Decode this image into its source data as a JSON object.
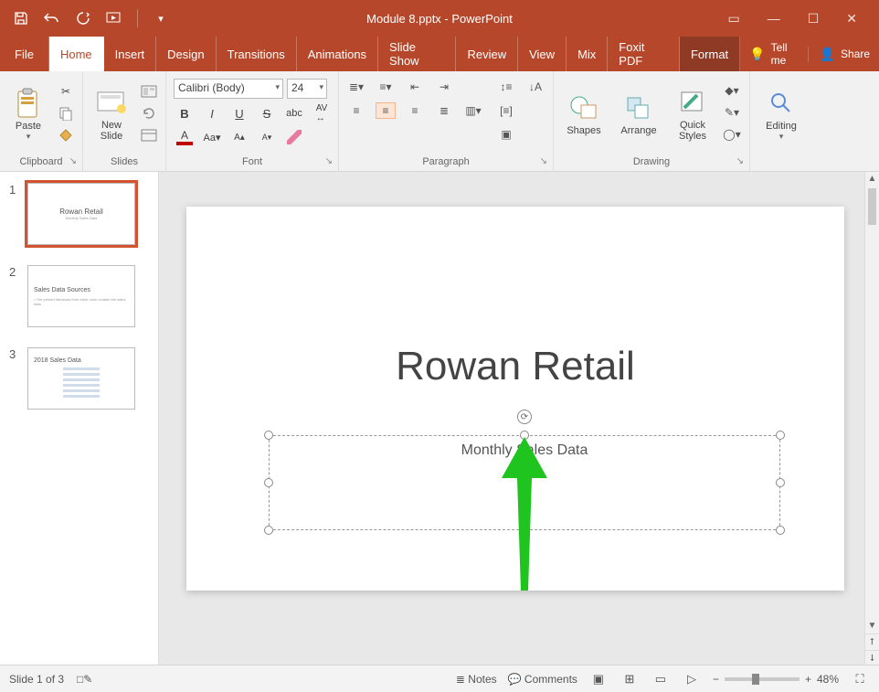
{
  "title": "Module 8.pptx - PowerPoint",
  "menu": {
    "file": "File",
    "home": "Home",
    "insert": "Insert",
    "design": "Design",
    "transitions": "Transitions",
    "animations": "Animations",
    "slideshow": "Slide Show",
    "review": "Review",
    "view": "View",
    "mix": "Mix",
    "foxit": "Foxit PDF",
    "format": "Format",
    "tellme": "Tell me",
    "share": "Share"
  },
  "ribbon": {
    "clipboard": {
      "paste": "Paste",
      "label": "Clipboard"
    },
    "slides": {
      "newslide": "New\nSlide",
      "label": "Slides"
    },
    "font": {
      "name": "Calibri (Body)",
      "size": "24",
      "label": "Font"
    },
    "paragraph": {
      "label": "Paragraph"
    },
    "drawing": {
      "shapes": "Shapes",
      "arrange": "Arrange",
      "quick": "Quick\nStyles",
      "label": "Drawing"
    },
    "editing": {
      "editing": "Editing"
    }
  },
  "thumbs": {
    "n1": "1",
    "n2": "2",
    "n3": "3",
    "s1_title": "Rowan Retail",
    "s2_title": "Sales Data Sources",
    "s3_title": "2018 Sales Data"
  },
  "slide": {
    "title": "Rowan Retail",
    "subtitle": "Monthly Sales Data"
  },
  "status": {
    "slideinfo": "Slide 1 of 3",
    "notes": "Notes",
    "comments": "Comments",
    "zoom": "48%"
  }
}
